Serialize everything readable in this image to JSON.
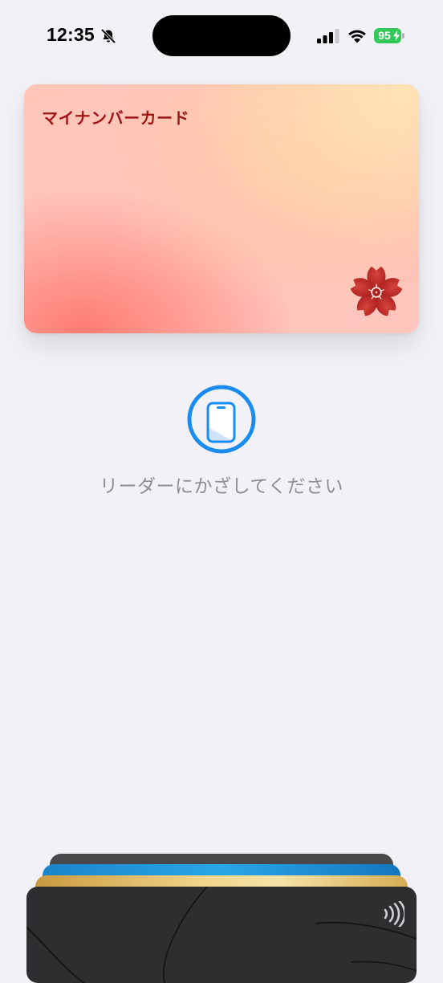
{
  "status_bar": {
    "time": "12:35",
    "battery_level": "95",
    "icons": [
      "bell-slash-icon",
      "cellular-signal-icon",
      "wifi-icon",
      "battery-charging-icon"
    ],
    "battery_color": "#34c759"
  },
  "card": {
    "title": "マイナンバーカード",
    "emblem": "sakura-icon",
    "title_color": "#a01616",
    "emblem_color": "#b91c1c"
  },
  "reader": {
    "icon": "phone-reader-icon",
    "prompt": "リーダーにかざしてください",
    "accent": "#1a8cf0"
  },
  "card_stack": {
    "cards": [
      {
        "name": "dark-gray-card",
        "color": "#3a3a3c"
      },
      {
        "name": "blue-card",
        "color": "#1a8ed6"
      },
      {
        "name": "gold-card",
        "color": "#e8c670"
      },
      {
        "name": "black-card",
        "color": "#2e2e30"
      }
    ],
    "front_card_icon": "contactless-icon"
  }
}
